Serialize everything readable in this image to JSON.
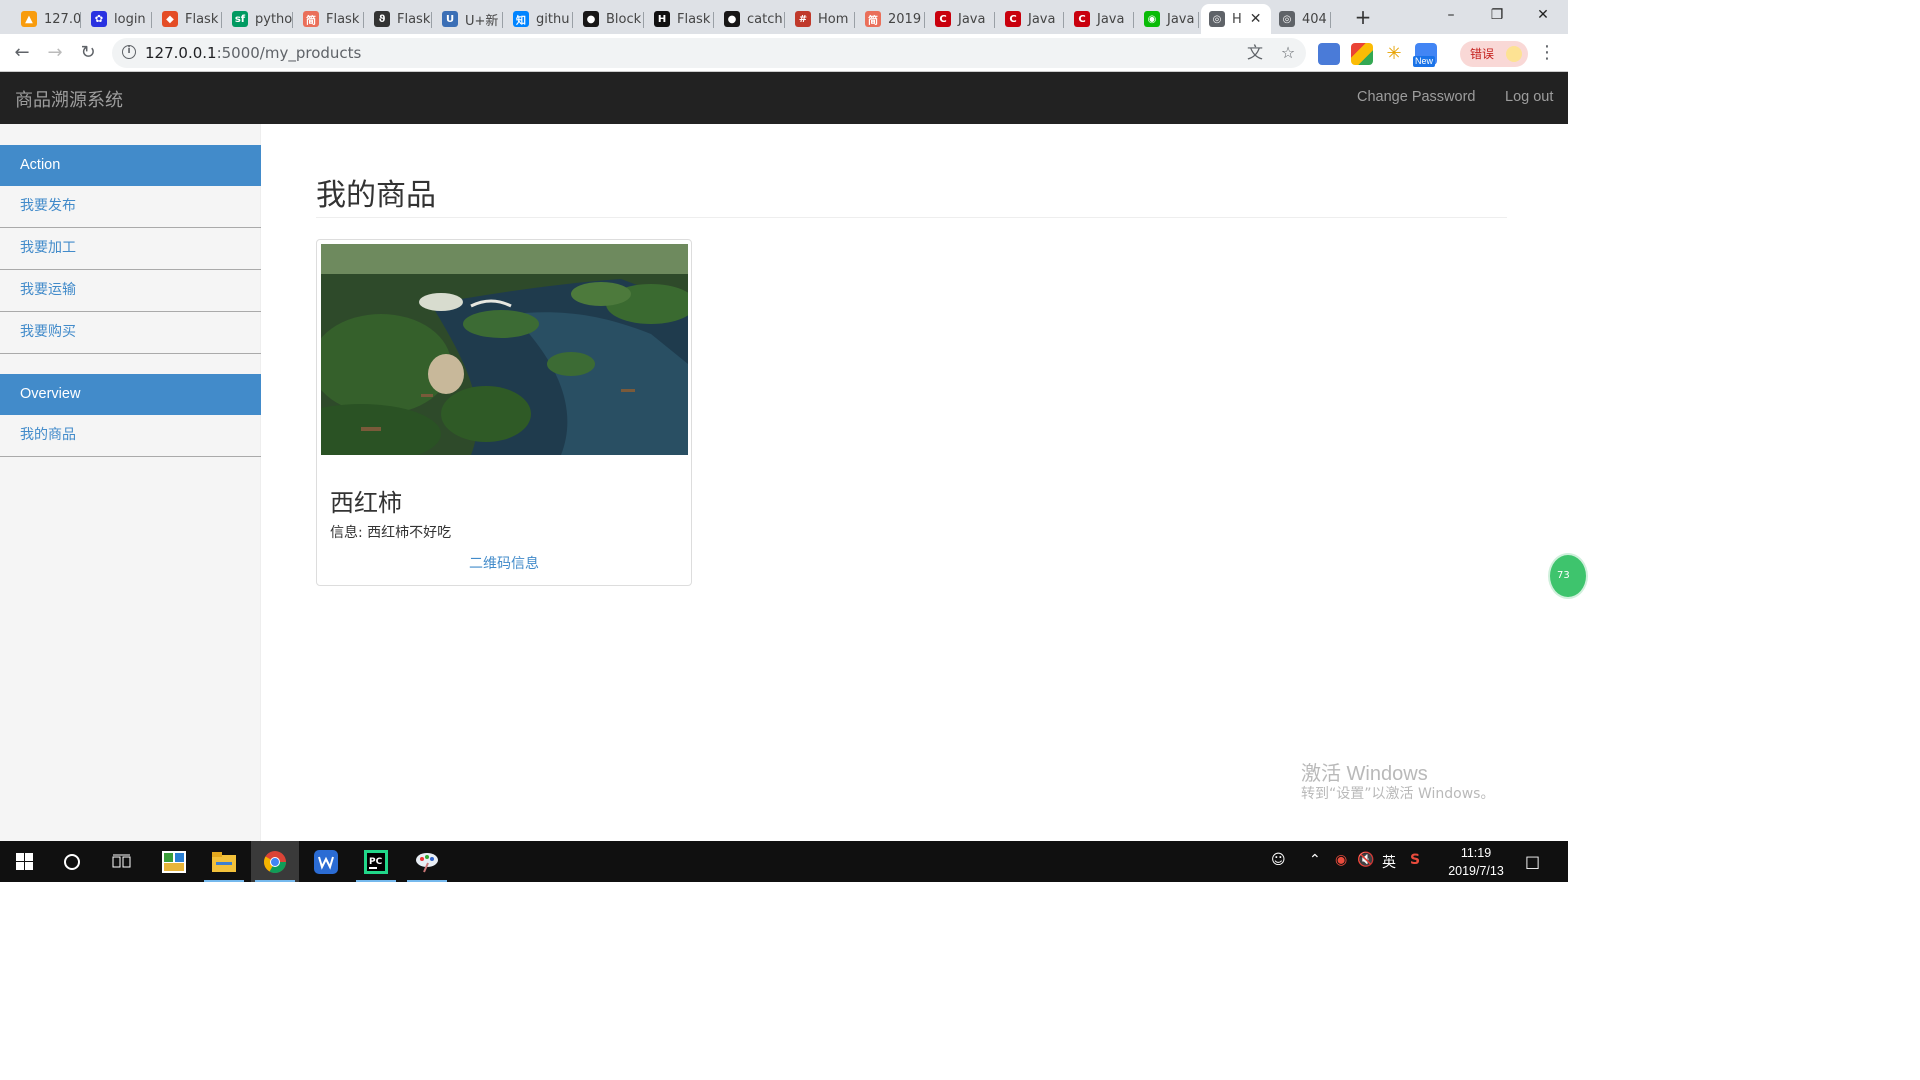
{
  "browser": {
    "tabs": [
      {
        "title": "127.0",
        "icon": "pma-icon",
        "color": "#f89c0e"
      },
      {
        "title": "login",
        "icon": "baidu-paw-icon",
        "color": "#2932e1"
      },
      {
        "title": "Flask",
        "icon": "flask-shield-icon",
        "color": "#e44d26"
      },
      {
        "title": "pytho",
        "icon": "segmentfault-icon",
        "color": "#009a61"
      },
      {
        "title": "Flask",
        "icon": "jianshu-icon",
        "color": "#ea6f5a"
      },
      {
        "title": "Flask",
        "icon": "flask-horn-icon",
        "color": "#333333"
      },
      {
        "title": "U+新",
        "icon": "u-plus-icon",
        "color": "#3b6fb6"
      },
      {
        "title": "githu",
        "icon": "zhihu-icon",
        "color": "#0084ff"
      },
      {
        "title": "Block",
        "icon": "github-icon",
        "color": "#181717"
      },
      {
        "title": "Flask",
        "icon": "h-logo-icon",
        "color": "#111111"
      },
      {
        "title": "catch",
        "icon": "github-icon",
        "color": "#181717"
      },
      {
        "title": "Hom",
        "icon": "hash-icon",
        "color": "#c0392b"
      },
      {
        "title": "2019",
        "icon": "jianshu-icon",
        "color": "#ea6f5a"
      },
      {
        "title": "Java",
        "icon": "csdn-icon",
        "color": "#c9000d"
      },
      {
        "title": "Java",
        "icon": "csdn-icon",
        "color": "#c9000d"
      },
      {
        "title": "Java",
        "icon": "csdn-icon",
        "color": "#c9000d"
      },
      {
        "title": "Java",
        "icon": "wechat-icon",
        "color": "#09bb07"
      },
      {
        "title": "H",
        "icon": "globe-icon",
        "color": "#5f6368",
        "active": true
      },
      {
        "title": "404",
        "icon": "globe-icon",
        "color": "#5f6368"
      }
    ],
    "url_host": "127.0.0.1",
    "url_path": ":5000/my_products",
    "profile_label": "错误",
    "ext_badge": "New"
  },
  "navbar": {
    "brand": "商品溯源系统",
    "links": [
      "Change Password",
      "Log out"
    ]
  },
  "sidebar": {
    "sections": [
      {
        "header": "Action",
        "items": [
          "我要发布",
          "我要加工",
          "我要运输",
          "我要购买"
        ]
      },
      {
        "header": "Overview",
        "items": [
          "我的商品"
        ]
      }
    ]
  },
  "main": {
    "title": "我的商品",
    "products": [
      {
        "name": "西红柿",
        "info": "信息: 西红柿不好吃",
        "link_label": "二维码信息"
      }
    ]
  },
  "floater_label": "73",
  "watermark": {
    "line1": "激活 Windows",
    "line2": "转到“设置”以激活 Windows。"
  },
  "taskbar": {
    "time": "11:19",
    "date": "2019/7/13",
    "ime": "英"
  },
  "colors": {
    "navbar_bg": "#222222",
    "sidebar_head": "#428bca",
    "link": "#428bca"
  }
}
